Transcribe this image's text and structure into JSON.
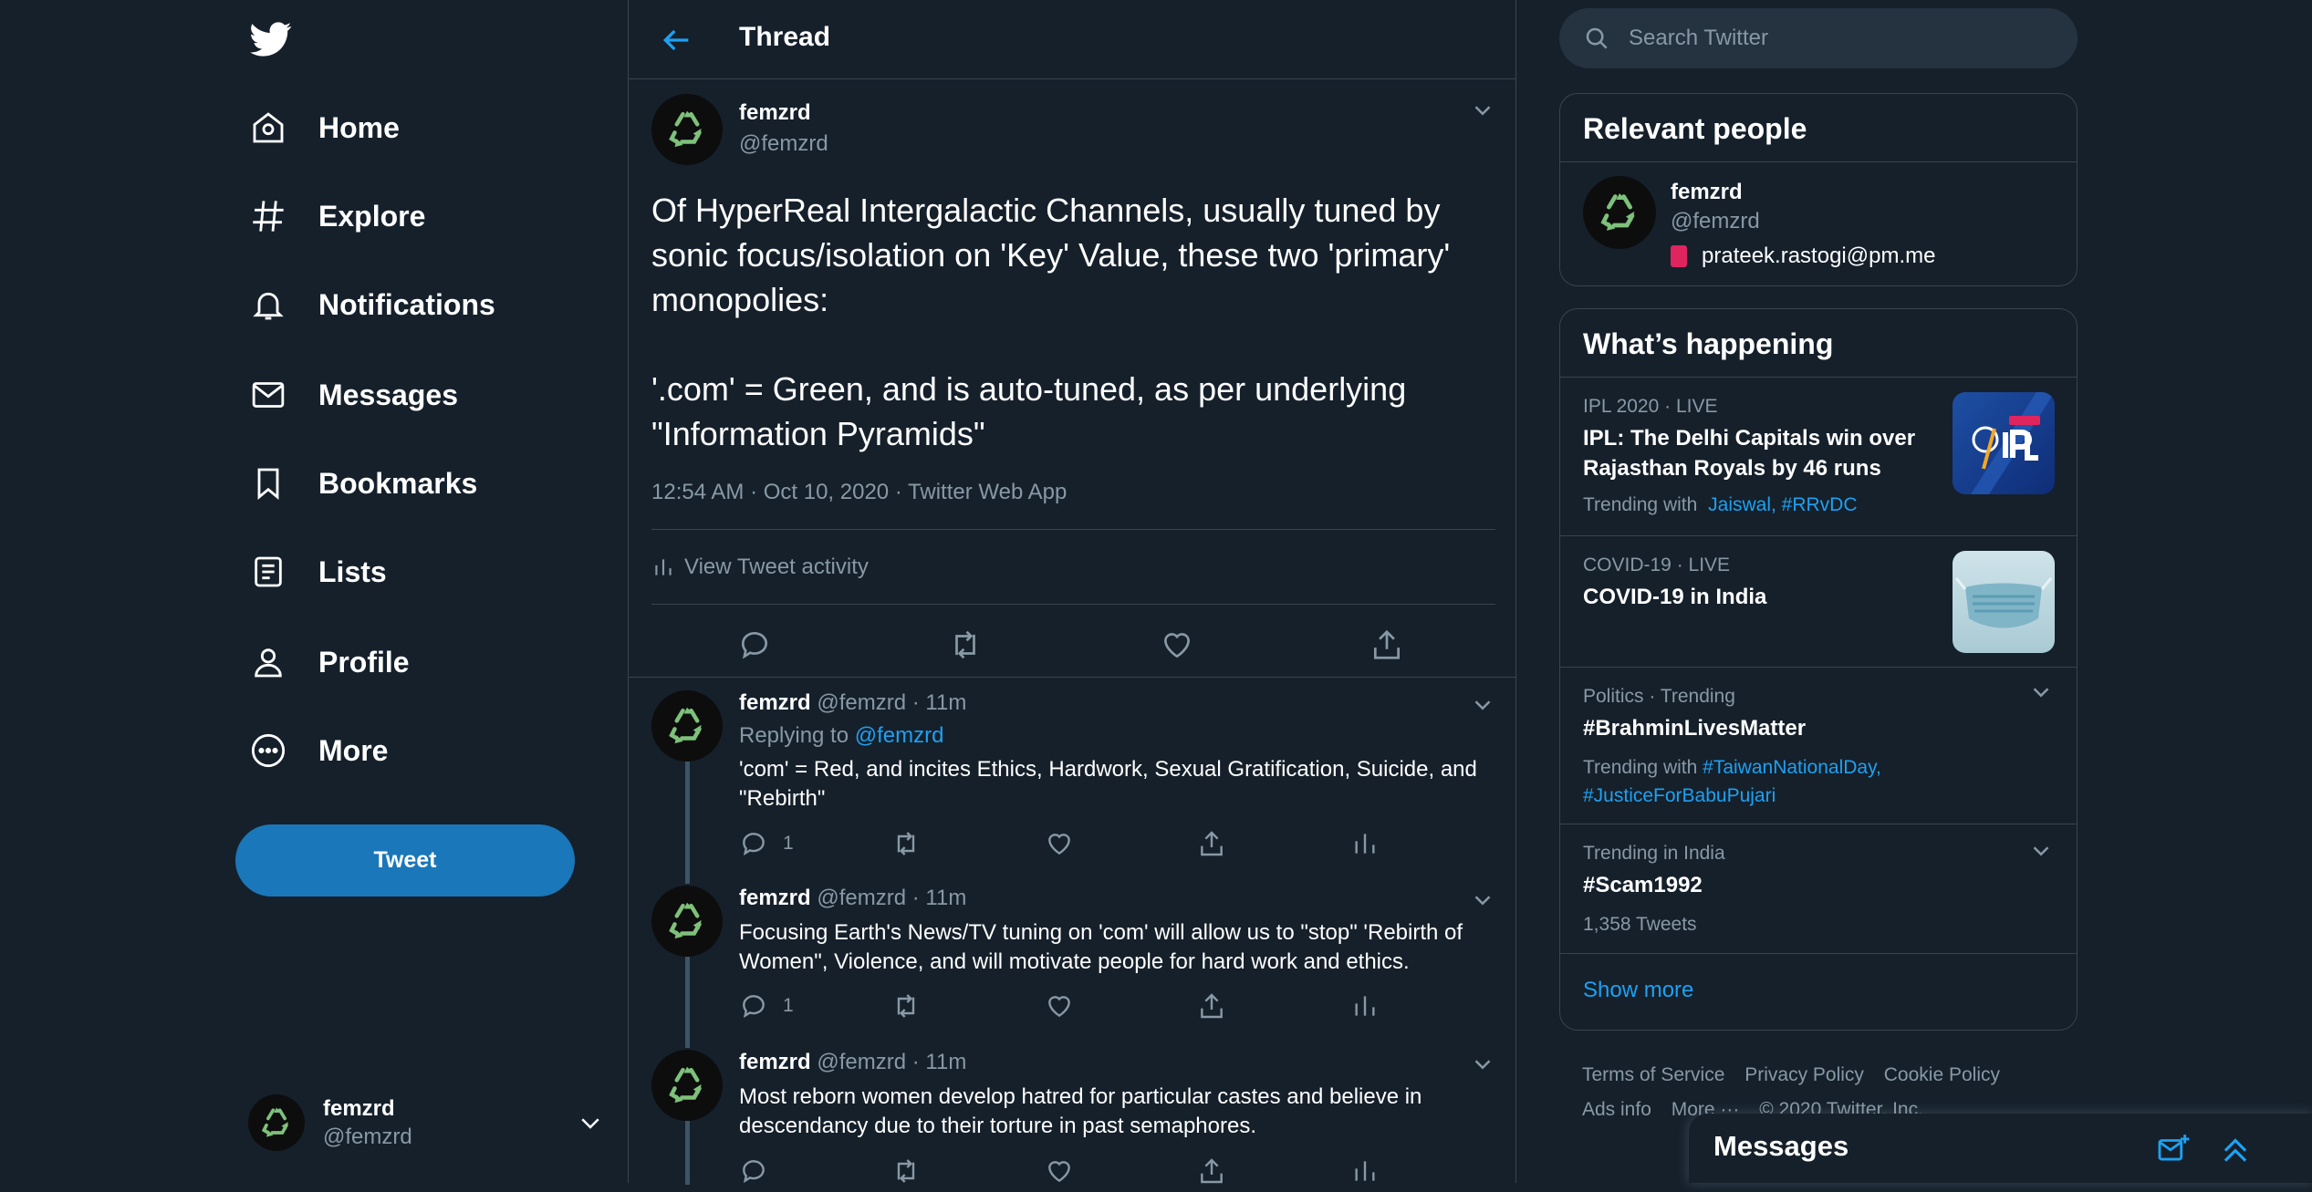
{
  "nav": {
    "items": [
      {
        "label": "Home",
        "icon": "home-icon"
      },
      {
        "label": "Explore",
        "icon": "hashtag-icon"
      },
      {
        "label": "Notifications",
        "icon": "bell-icon"
      },
      {
        "label": "Messages",
        "icon": "mail-icon"
      },
      {
        "label": "Bookmarks",
        "icon": "bookmark-icon"
      },
      {
        "label": "Lists",
        "icon": "list-icon"
      },
      {
        "label": "Profile",
        "icon": "person-icon"
      },
      {
        "label": "More",
        "icon": "more-circle-icon"
      }
    ],
    "tweet_button": "Tweet"
  },
  "account": {
    "name": "femzrd",
    "handle": "@femzrd"
  },
  "header": {
    "title": "Thread"
  },
  "main_tweet": {
    "name": "femzrd",
    "handle": "@femzrd",
    "text": "Of HyperReal Intergalactic Channels, usually tuned by sonic focus/isolation on 'Key' Value, these two 'primary' monopolies:\n\n'.com' = Green, and is auto-tuned, as per underlying \"Information Pyramids\"",
    "meta": "12:54 AM · Oct 10, 2020 · Twitter Web App",
    "activity_label": "View Tweet activity"
  },
  "replies": [
    {
      "name": "femzrd",
      "meta": "@femzrd · 11m",
      "replying_prefix": "Replying to",
      "replying_to": "@femzrd",
      "text": "'com' = Red, and incites Ethics, Hardwork, Sexual Gratification, Suicide, and \"Rebirth\"",
      "reply_count": "1"
    },
    {
      "name": "femzrd",
      "meta": "@femzrd · 11m",
      "text": "Focusing Earth's News/TV tuning on 'com' will allow us to \"stop\" 'Rebirth of Women\", Violence, and will motivate people for hard work and ethics.",
      "reply_count": "1"
    },
    {
      "name": "femzrd",
      "meta": "@femzrd · 11m",
      "text": "Most reborn women develop hatred for particular castes and believe in descendancy due to their torture in past semaphores.",
      "reply_count": ""
    }
  ],
  "search": {
    "placeholder": "Search Twitter"
  },
  "relevant": {
    "title": "Relevant people",
    "name": "femzrd",
    "handle": "@femzrd",
    "bio": "prateek.rastogi@pm.me"
  },
  "happening": {
    "title": "What’s happening",
    "trends": [
      {
        "category": "IPL 2020 · LIVE",
        "title": "IPL: The Delhi Capitals win over Rajasthan Royals by 46 runs",
        "sub_prefix": "Trending with",
        "sub_links": "Jaiswal, #RRvDC"
      },
      {
        "category": "COVID-19 · LIVE",
        "title": "COVID-19 in India"
      },
      {
        "category": "Politics · Trending",
        "title": "#BrahminLivesMatter",
        "sub_prefix": "Trending with",
        "sub_links": "#TaiwanNationalDay, #JusticeForBabuPujari"
      },
      {
        "category": "Trending in India",
        "title": "#Scam1992",
        "count": "1,358 Tweets"
      }
    ],
    "show_more": "Show more"
  },
  "footer": {
    "links": [
      "Terms of Service",
      "Privacy Policy",
      "Cookie Policy",
      "Ads info",
      "More ···",
      "© 2020 Twitter, Inc."
    ]
  },
  "messages_drawer": {
    "title": "Messages"
  },
  "colors": {
    "background": "#15202b",
    "accent": "#1da1f2",
    "border": "#38444d",
    "muted": "#8899a6",
    "tweet_button": "#1a77b9",
    "recycle_green": "#7ec17b"
  }
}
